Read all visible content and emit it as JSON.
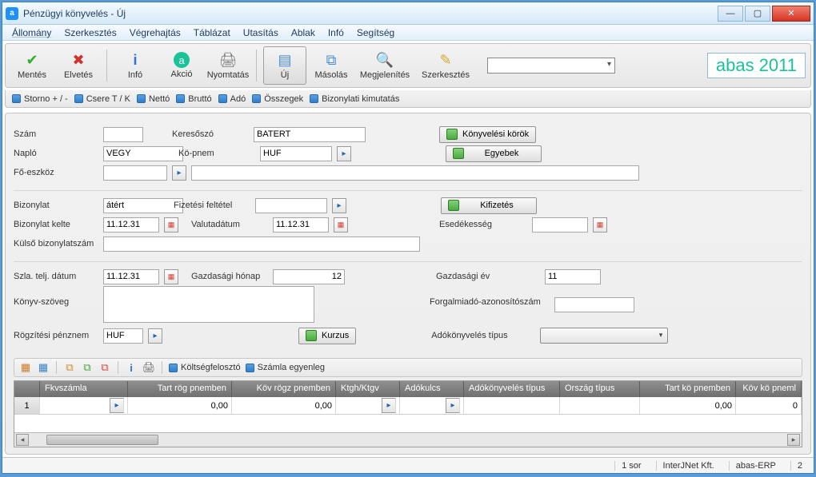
{
  "titlebar": {
    "title": "Pénzügyi könyvelés - Új"
  },
  "menu": {
    "m0": "Állomány",
    "m1": "Szerkesztés",
    "m2": "Végrehajtás",
    "m3": "Táblázat",
    "m4": "Utasítás",
    "m5": "Ablak",
    "m6": "Infó",
    "m7": "Segítség"
  },
  "tools": {
    "save": "Mentés",
    "discard": "Elvetés",
    "info": "Infó",
    "action": "Akció",
    "print": "Nyomtatás",
    "new": "Új",
    "copy": "Másolás",
    "show": "Megjelenítés",
    "edit": "Szerkesztés"
  },
  "brand": "abas 2011",
  "tags": {
    "t0": "Storno + / -",
    "t1": "Csere   T / K",
    "t2": "Nettó",
    "t3": "Bruttó",
    "t4": "Adó",
    "t5": "Összegek",
    "t6": "Bizonylati kimutatás"
  },
  "labels": {
    "szam": "Szám",
    "keres": "Keresőszó",
    "konyvk": "Könyvelési körök",
    "naplo": "Napló",
    "kopnem": "Kö-pnem",
    "egyeb": "Egyebek",
    "foeszk": "Fő-eszköz",
    "biz": "Bizonylat",
    "fizfel": "Fizetési feltétel",
    "kifiz": "Kifizetés",
    "bizkelte": "Bizonylat kelte",
    "valdat": "Valutadátum",
    "esed": "Esedékesség",
    "kulso": "Külső bizonylatszám",
    "szladat": "Szla. telj. dátum",
    "gazho": "Gazdasági hónap",
    "gazev": "Gazdasági év",
    "kszoveg": "Könyv-szöveg",
    "forgazon": "Forgalmiadó-azonosítószám",
    "rogzpnem": "Rögzítési pénznem",
    "kurzus": "Kurzus",
    "adotip": "Adókönyvelés típus",
    "kfeloszt": "Költségfelosztó",
    "szegy": "Számla egyenleg"
  },
  "values": {
    "keres": "BATERT",
    "naplo": "VEGY",
    "kopnem": "HUF",
    "biz": "átért",
    "bizkelte": "11.12.31",
    "valdat": "11.12.31",
    "szladat": "11.12.31",
    "gazho": "12",
    "gazev": "11",
    "rogzpnem": "HUF"
  },
  "grid": {
    "h0": "Fkvszámla",
    "h1": "Tart rög pnemben",
    "h2": "Köv rögz pnemben",
    "h3": "Ktgh/Ktgv",
    "h4": "Adókulcs",
    "h5": "Adókönyvelés típus",
    "h6": "Ország típus",
    "h7": "Tart kö pnemben",
    "h8": "Köv kö pneml",
    "r1": {
      "n": "1",
      "c1": "0,00",
      "c2": "0,00",
      "c7": "0,00",
      "c8": "0"
    }
  },
  "status": {
    "s0": "1 sor",
    "s1": "InterJNet Kft.",
    "s2": "abas-ERP",
    "s3": "2"
  }
}
